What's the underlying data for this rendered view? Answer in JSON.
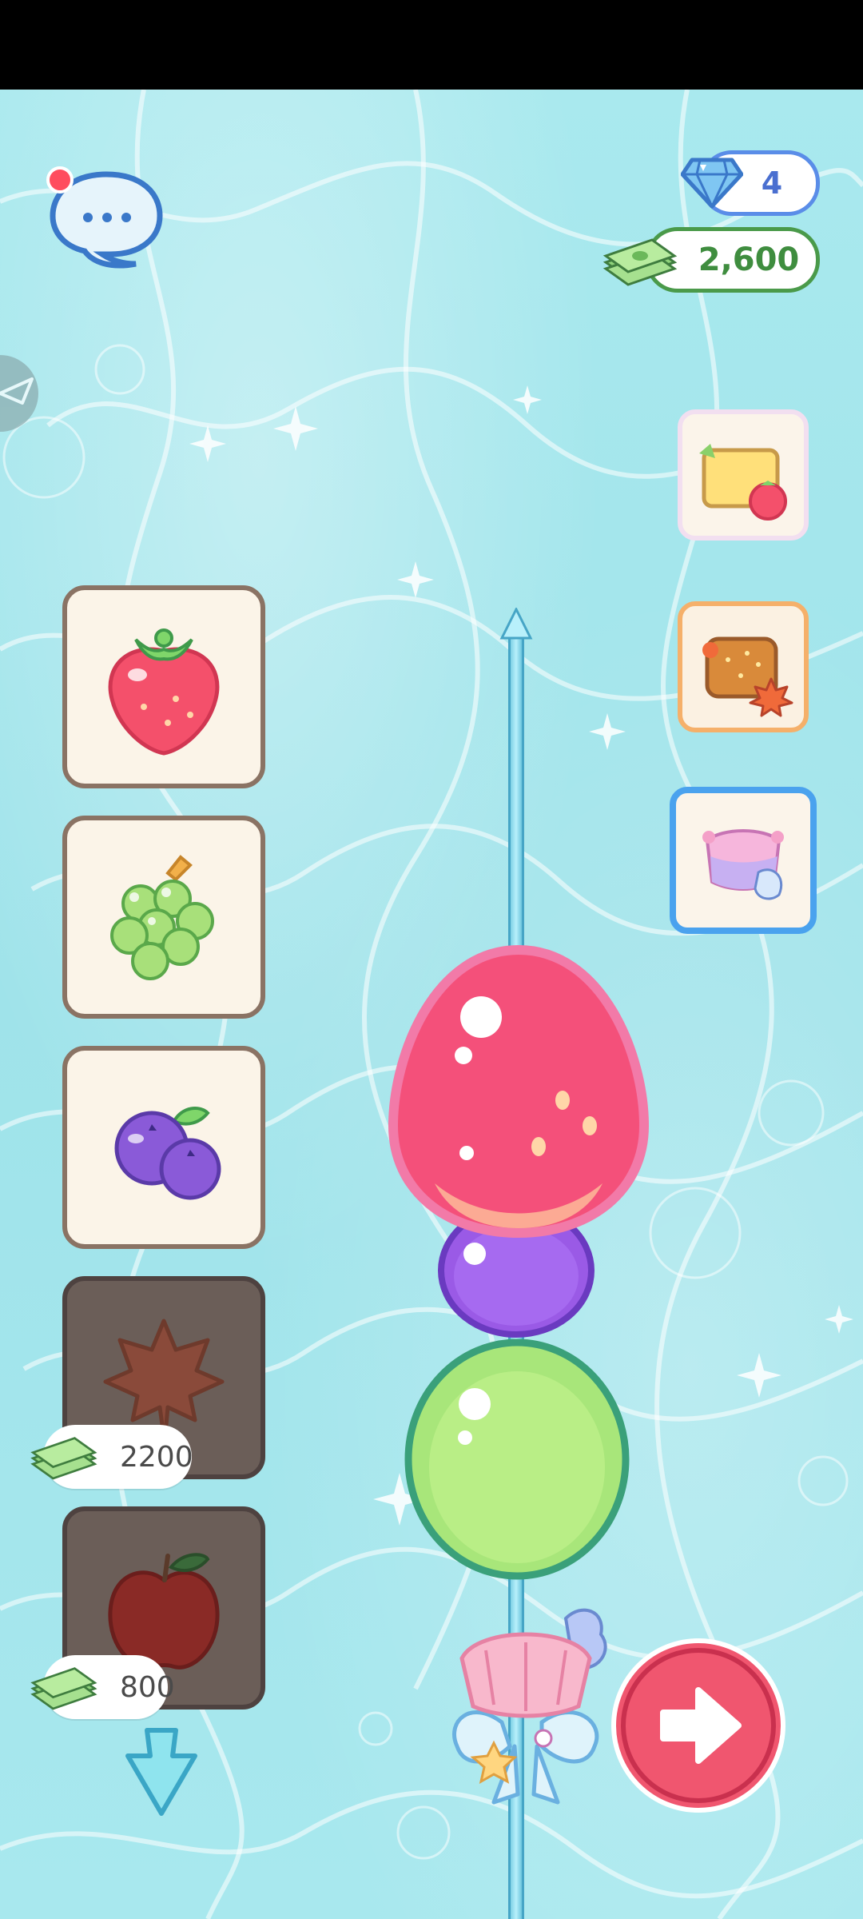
{
  "currency": {
    "gems": "4",
    "cash": "2,600"
  },
  "icons": {
    "chat": "chat-bubble-icon",
    "gem": "diamond-icon",
    "cash": "cash-stack-icon",
    "side_tab": "paper-plane-icon",
    "confirm": "arrow-right-icon",
    "drop": "drop-arrow-icon"
  },
  "fruit_slots": [
    {
      "name": "strawberry",
      "locked": false
    },
    {
      "name": "green-grapes",
      "locked": false
    },
    {
      "name": "blueberries",
      "locked": false
    },
    {
      "name": "maple-leaf",
      "locked": true,
      "price": "2200"
    },
    {
      "name": "apple",
      "locked": true,
      "price": "800"
    }
  ],
  "decor_cards": [
    {
      "name": "strawberry-toast-decor"
    },
    {
      "name": "autumn-maple-decor"
    },
    {
      "name": "seashell-pink-decor",
      "selected": true
    }
  ],
  "skewer": {
    "pieces_top_to_bottom": [
      "strawberry",
      "blueberry",
      "green-grape"
    ],
    "ornament": "seashell-bow"
  },
  "colors": {
    "background": "#a4e6ec",
    "gem_border": "#5a8de8",
    "cash_border": "#4a9a4a",
    "confirm_button": "#f0566f"
  }
}
